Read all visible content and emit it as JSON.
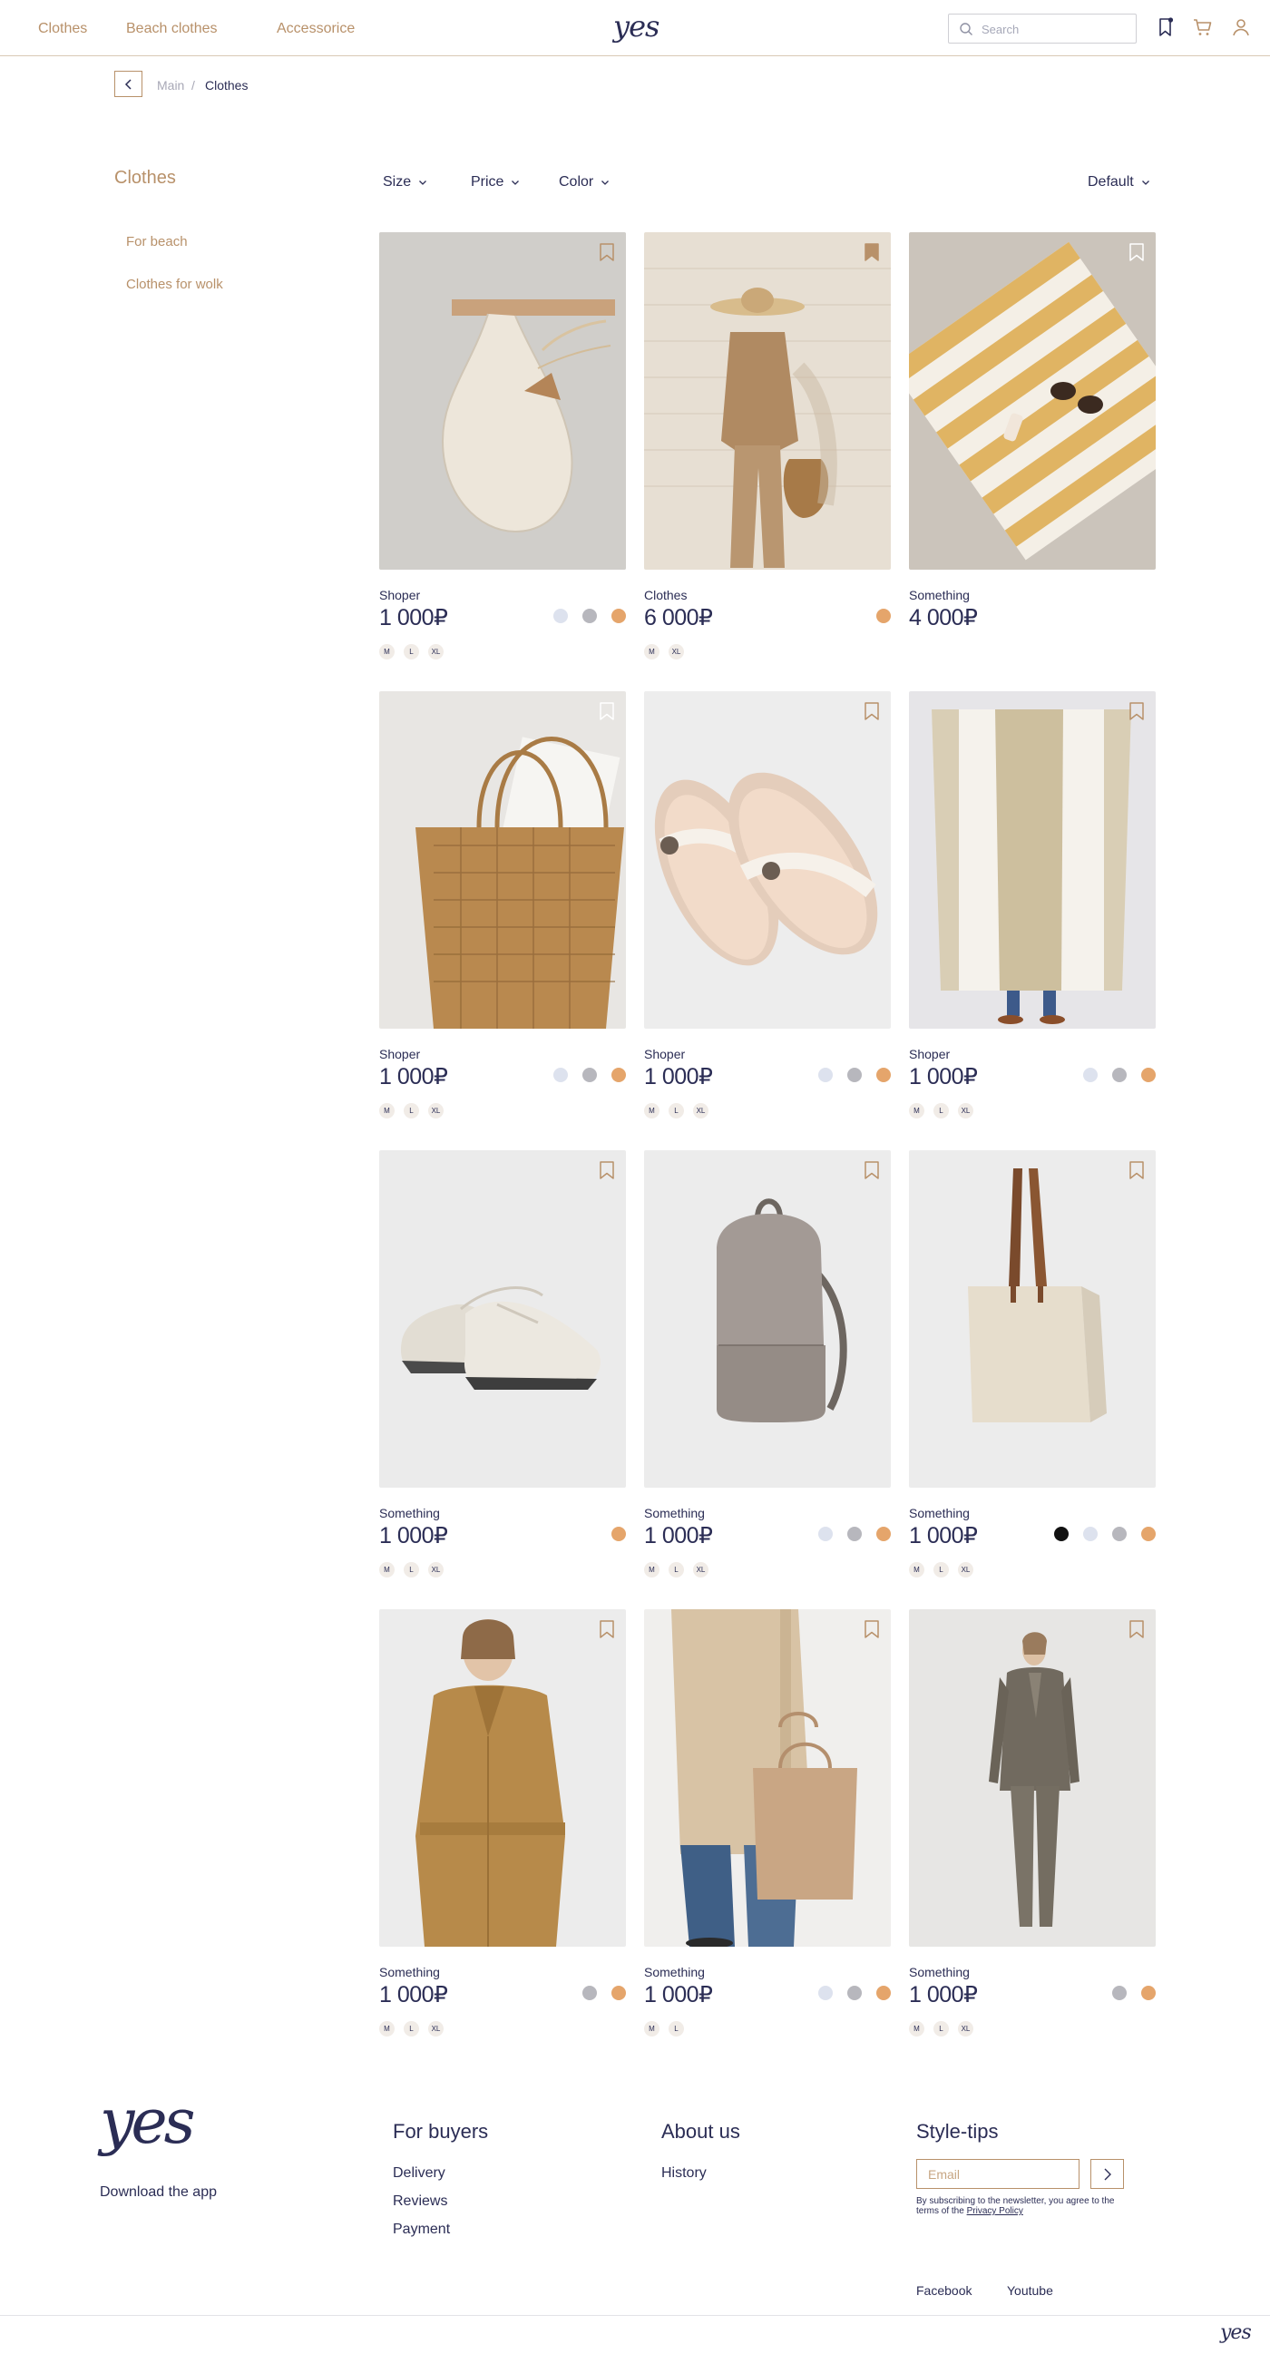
{
  "header": {
    "nav": [
      "Clothes",
      "Beach clothes",
      "Accessorice"
    ],
    "logo": "yes",
    "search_placeholder": "Search",
    "icons": [
      "bookmark-icon",
      "cart-icon",
      "user-icon"
    ]
  },
  "breadcrumb": {
    "items": [
      "Main",
      "Clothes"
    ],
    "separator": "/"
  },
  "sidebar": {
    "title": "Clothes",
    "items": [
      "For beach",
      "Clothes for wolk"
    ]
  },
  "filters": {
    "items": [
      "Size",
      "Price",
      "Color"
    ],
    "sort": "Default"
  },
  "colors": {
    "accent": "#b8916a",
    "text": "#2b2d55",
    "swatch_light": "#dde2ee",
    "swatch_gray": "#b7b7bd",
    "swatch_orange": "#e5a56b",
    "swatch_black": "#111111"
  },
  "products": [
    {
      "category": "Shoper",
      "price": "1 000₽",
      "swatches": [
        "light",
        "gray",
        "orange"
      ],
      "sizes": [
        "M",
        "L",
        "XL"
      ],
      "image": "mesh-bag-on-hook"
    },
    {
      "category": "Clothes",
      "price": "6 000₽",
      "swatches": [
        "orange"
      ],
      "sizes": [
        "M",
        "XL"
      ],
      "image": "woman-in-beige-suit"
    },
    {
      "category": "Something",
      "price": "4 000₽",
      "swatches": [],
      "sizes": [],
      "image": "striped-beach-towel"
    },
    {
      "category": "Shoper",
      "price": "1 000₽",
      "swatches": [
        "light",
        "gray",
        "orange"
      ],
      "sizes": [
        "M",
        "L",
        "XL"
      ],
      "image": "straw-tote-bag"
    },
    {
      "category": "Shoper",
      "price": "1 000₽",
      "swatches": [
        "light",
        "gray",
        "orange"
      ],
      "sizes": [
        "M",
        "L",
        "XL"
      ],
      "image": "flip-flops"
    },
    {
      "category": "Shoper",
      "price": "1 000₽",
      "swatches": [
        "light",
        "gray",
        "orange"
      ],
      "sizes": [
        "M",
        "L",
        "XL"
      ],
      "image": "striped-towel-held"
    },
    {
      "category": "Something",
      "price": "1 000₽",
      "swatches": [
        "orange"
      ],
      "sizes": [
        "M",
        "L",
        "XL"
      ],
      "image": "white-sneakers"
    },
    {
      "category": "Something",
      "price": "1 000₽",
      "swatches": [
        "light",
        "gray",
        "orange"
      ],
      "sizes": [
        "M",
        "L",
        "XL"
      ],
      "image": "gray-backpack"
    },
    {
      "category": "Something",
      "price": "1 000₽",
      "swatches": [
        "black",
        "light",
        "gray",
        "orange"
      ],
      "sizes": [
        "M",
        "L",
        "XL"
      ],
      "image": "canvas-tote"
    },
    {
      "category": "Something",
      "price": "1 000₽",
      "swatches": [
        "gray",
        "orange"
      ],
      "sizes": [
        "M",
        "L",
        "XL"
      ],
      "image": "camel-trench-coat"
    },
    {
      "category": "Something",
      "price": "1 000₽",
      "swatches": [
        "light",
        "gray",
        "orange"
      ],
      "sizes": [
        "M",
        "L"
      ],
      "image": "coat-with-tote"
    },
    {
      "category": "Something",
      "price": "1 000₽",
      "swatches": [
        "gray",
        "orange"
      ],
      "sizes": [
        "M",
        "L",
        "XL"
      ],
      "image": "olive-suit"
    }
  ],
  "footer": {
    "logo": "yes",
    "download": "Download the app",
    "buyers": {
      "title": "For buyers",
      "links": [
        "Delivery",
        "Reviews",
        "Payment"
      ]
    },
    "about": {
      "title": "About us",
      "links": [
        "History"
      ]
    },
    "style": {
      "title": "Style-tips",
      "email_placeholder": "Email",
      "consent": "By subscribing to the newsletter, you agree to the terms of the",
      "privacy": "Privacy Policy"
    },
    "social": [
      "Facebook",
      "Youtube"
    ],
    "small_logo": "yes"
  }
}
